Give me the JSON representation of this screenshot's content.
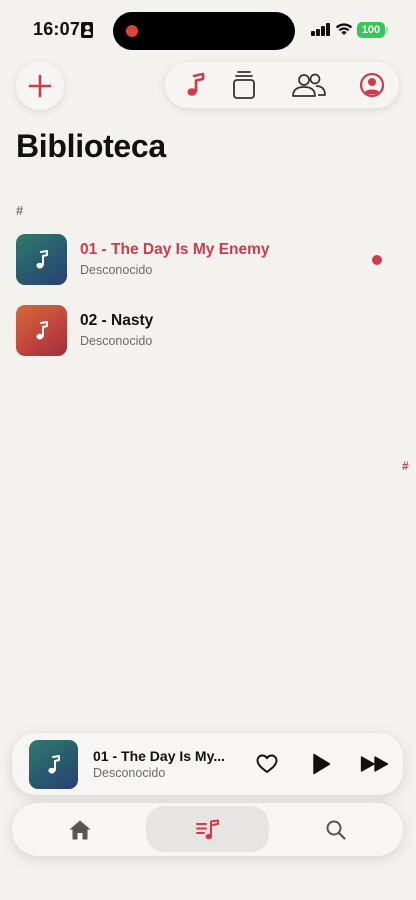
{
  "status_bar": {
    "time": "16:07",
    "battery": "100",
    "battery_color": "#34c759",
    "icons": [
      "person-badge-icon",
      "recording-dot-icon",
      "cellular-signal-icon",
      "wifi-icon",
      "battery-icon"
    ]
  },
  "top_bar": {
    "add_icon": "plus-icon",
    "nav_icons": [
      "music-note-icon",
      "albums-stack-icon",
      "artists-icon",
      "account-icon"
    ],
    "accent_color": "#d03a4a"
  },
  "library": {
    "title": "Biblioteca",
    "section_header": "#",
    "index_letter": "#",
    "tracks": [
      {
        "title": "01 - The Day Is My Enemy",
        "artist": "Desconocido",
        "playing": true,
        "title_color": "#d03a4a"
      },
      {
        "title": "02 - Nasty",
        "artist": "Desconocido",
        "playing": false,
        "title_color": "#111111"
      }
    ]
  },
  "mini_player": {
    "title": "01 - The Day Is My...",
    "artist": "Desconocido",
    "controls": [
      "heart-icon",
      "play-icon",
      "fast-forward-icon"
    ]
  },
  "tab_bar": {
    "tabs": [
      "home-icon",
      "library-icon",
      "search-icon"
    ],
    "selected": "library-icon"
  }
}
